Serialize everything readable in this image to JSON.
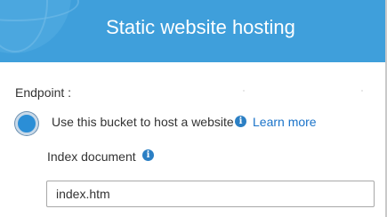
{
  "header": {
    "title": "Static website hosting"
  },
  "endpoint": {
    "label": "Endpoint :"
  },
  "hosting_option": {
    "label": "Use this bucket to host a website",
    "selected": true,
    "info_icon": "info-icon",
    "learn_more": "Learn more"
  },
  "index_document": {
    "label": "Index document",
    "info_icon": "info-icon",
    "value": "index.htm"
  },
  "colors": {
    "header_background": "#3f9fdb",
    "radio_selected": "#2b8ed6",
    "link": "#1a73c9",
    "info_icon": "#2b7fc4"
  }
}
